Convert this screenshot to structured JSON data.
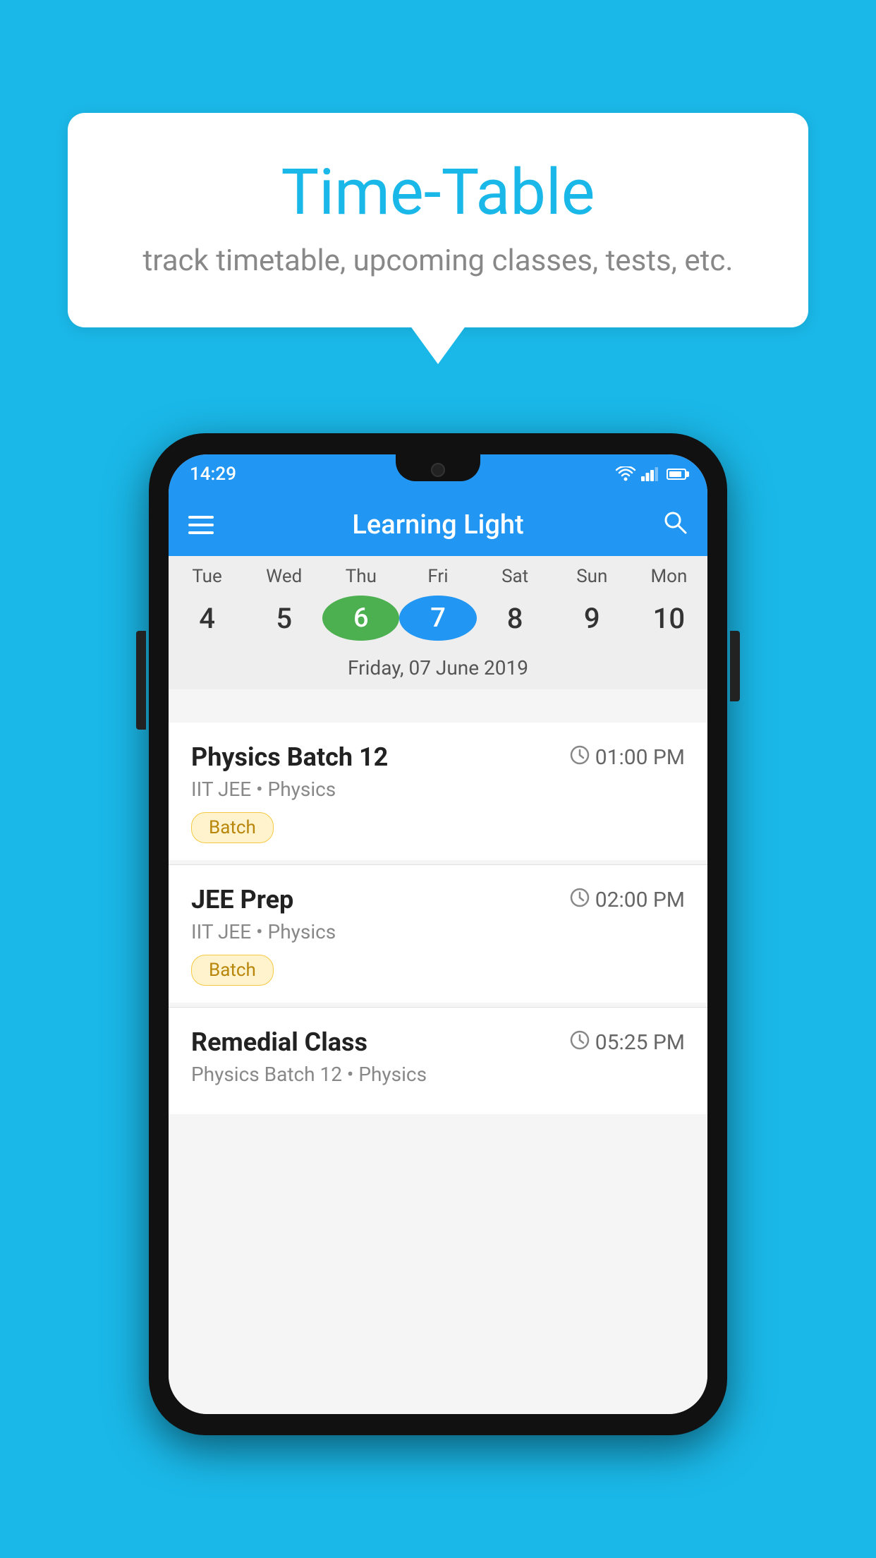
{
  "background": {
    "color": "#1ab8e8"
  },
  "bubble": {
    "title": "Time-Table",
    "subtitle": "track timetable, upcoming classes, tests, etc."
  },
  "phone": {
    "status_bar": {
      "time": "14:29"
    },
    "toolbar": {
      "title": "Learning Light"
    },
    "calendar": {
      "days": [
        {
          "name": "Tue",
          "number": "4",
          "state": "normal"
        },
        {
          "name": "Wed",
          "number": "5",
          "state": "normal"
        },
        {
          "name": "Thu",
          "number": "6",
          "state": "today"
        },
        {
          "name": "Fri",
          "number": "7",
          "state": "selected"
        },
        {
          "name": "Sat",
          "number": "8",
          "state": "normal"
        },
        {
          "name": "Sun",
          "number": "9",
          "state": "normal"
        },
        {
          "name": "Mon",
          "number": "10",
          "state": "normal"
        }
      ],
      "selected_date_label": "Friday, 07 June 2019"
    },
    "schedule": {
      "items": [
        {
          "title": "Physics Batch 12",
          "time": "01:00 PM",
          "sub": "IIT JEE • Physics",
          "tag": "Batch"
        },
        {
          "title": "JEE Prep",
          "time": "02:00 PM",
          "sub": "IIT JEE • Physics",
          "tag": "Batch"
        },
        {
          "title": "Remedial Class",
          "time": "05:25 PM",
          "sub": "Physics Batch 12 • Physics",
          "tag": ""
        }
      ]
    }
  }
}
